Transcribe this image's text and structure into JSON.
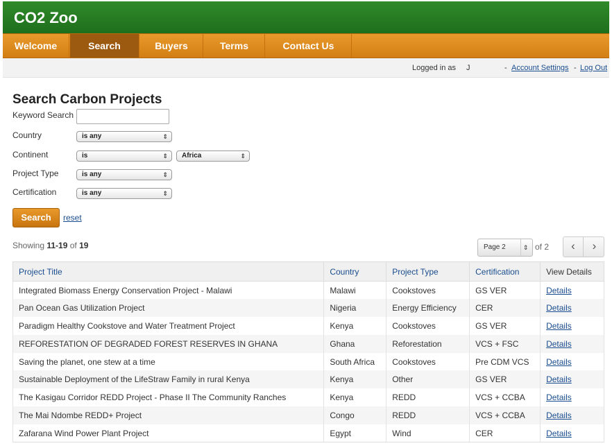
{
  "site": {
    "title": "CO2 Zoo"
  },
  "nav": {
    "items": [
      {
        "label": "Welcome"
      },
      {
        "label": "Search"
      },
      {
        "label": "Buyers"
      },
      {
        "label": "Terms"
      },
      {
        "label": "Contact Us"
      }
    ],
    "active": "Search"
  },
  "userbar": {
    "logged_in_label": "Logged in as",
    "user_name": "J",
    "separator1": "-",
    "account_settings": "Account Settings",
    "separator2": "-",
    "logout": "Log Out"
  },
  "search": {
    "title": "Search Carbon Projects",
    "keyword_label": "Keyword Search",
    "keyword_value": "",
    "country_label": "Country",
    "country_op": "is any",
    "continent_label": "Continent",
    "continent_op": "is",
    "continent_value": "Africa",
    "project_type_label": "Project Type",
    "project_type_op": "is any",
    "certification_label": "Certification",
    "certification_op": "is any",
    "search_button": "Search",
    "reset_link": "reset"
  },
  "results": {
    "showing_prefix": "Showing",
    "range": "11-19",
    "of_label": "of",
    "total": "19",
    "page_select": "Page 2",
    "page_of": "of 2",
    "prev_icon": "‹",
    "next_icon": "›"
  },
  "table": {
    "headers": [
      "Project Title",
      "Country",
      "Project Type",
      "Certification",
      "View Details"
    ],
    "rows": [
      {
        "title": "Integrated Biomass Energy Conservation Project - Malawi",
        "country": "Malawi",
        "type": "Cookstoves",
        "cert": "GS VER",
        "link": "Details"
      },
      {
        "title": "Pan Ocean Gas Utilization Project",
        "country": "Nigeria",
        "type": "Energy Efficiency",
        "cert": "CER",
        "link": "Details"
      },
      {
        "title": "Paradigm Healthy Cookstove and Water Treatment Project",
        "country": "Kenya",
        "type": "Cookstoves",
        "cert": "GS VER",
        "link": "Details"
      },
      {
        "title": "REFORESTATION OF DEGRADED FOREST RESERVES IN GHANA",
        "country": "Ghana",
        "type": "Reforestation",
        "cert": "VCS + FSC",
        "link": "Details"
      },
      {
        "title": "Saving the planet, one stew at a time",
        "country": "South Africa",
        "type": "Cookstoves",
        "cert": "Pre CDM VCS",
        "link": "Details"
      },
      {
        "title": "Sustainable Deployment of the LifeStraw Family in rural Kenya",
        "country": "Kenya",
        "type": "Other",
        "cert": "GS VER",
        "link": "Details"
      },
      {
        "title": "The Kasigau Corridor REDD Project - Phase II The Community Ranches",
        "country": "Kenya",
        "type": "REDD",
        "cert": "VCS + CCBA",
        "link": "Details"
      },
      {
        "title": "The Mai Ndombe REDD+ Project",
        "country": "Congo",
        "type": "REDD",
        "cert": "VCS + CCBA",
        "link": "Details"
      },
      {
        "title": "Zafarana Wind Power Plant Project",
        "country": "Egypt",
        "type": "Wind",
        "cert": "CER",
        "link": "Details"
      }
    ]
  }
}
